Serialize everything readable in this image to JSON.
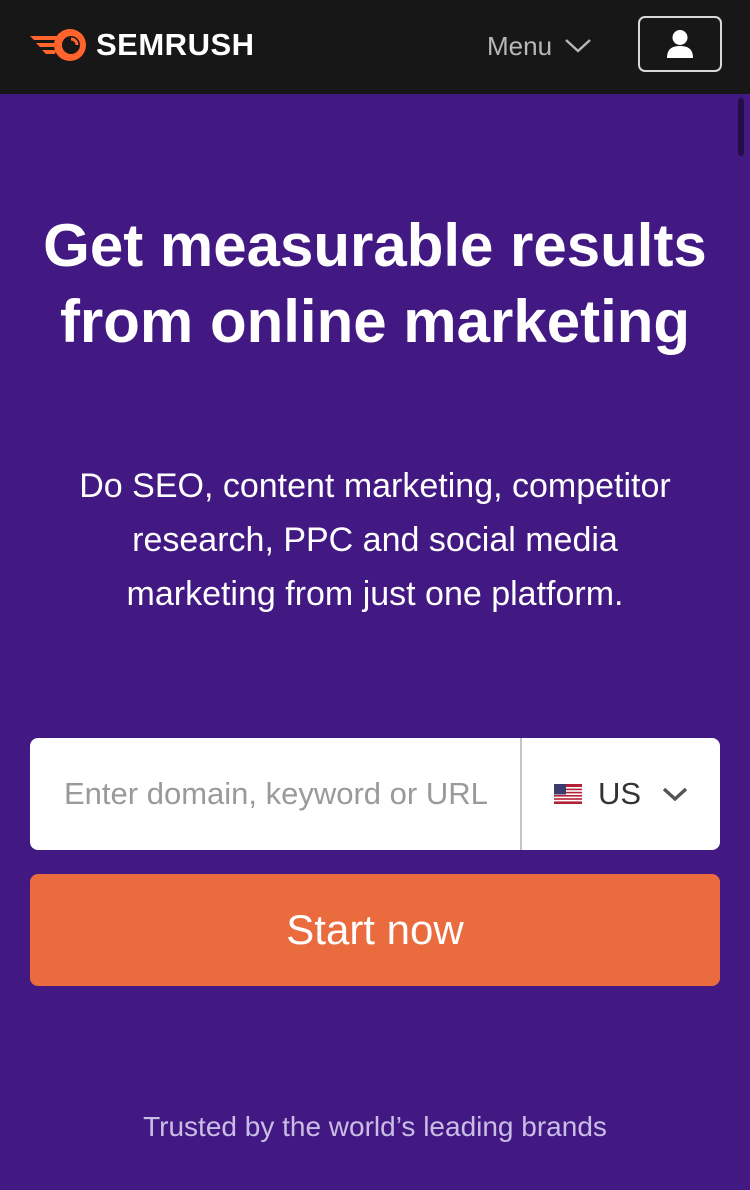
{
  "header": {
    "logo_text": "SEMRUSH",
    "logo_icon": "semrush-fireball-icon",
    "menu_label": "Menu",
    "user_icon": "user-icon"
  },
  "hero": {
    "title": "Get measurable results from online marketing",
    "subtitle": "Do SEO, content marketing, competitor research, PPC and social media marketing from just one platform."
  },
  "search": {
    "placeholder": "Enter domain, keyword or URL",
    "database": "US",
    "database_icon": "us-flag-icon",
    "cta_label": "Start now"
  },
  "footer": {
    "trusted_text": "Trusted by the world’s leading brands"
  },
  "colors": {
    "brand_purple": "#421983",
    "brand_orange": "#ea6b3e",
    "header_bg": "#171717"
  }
}
